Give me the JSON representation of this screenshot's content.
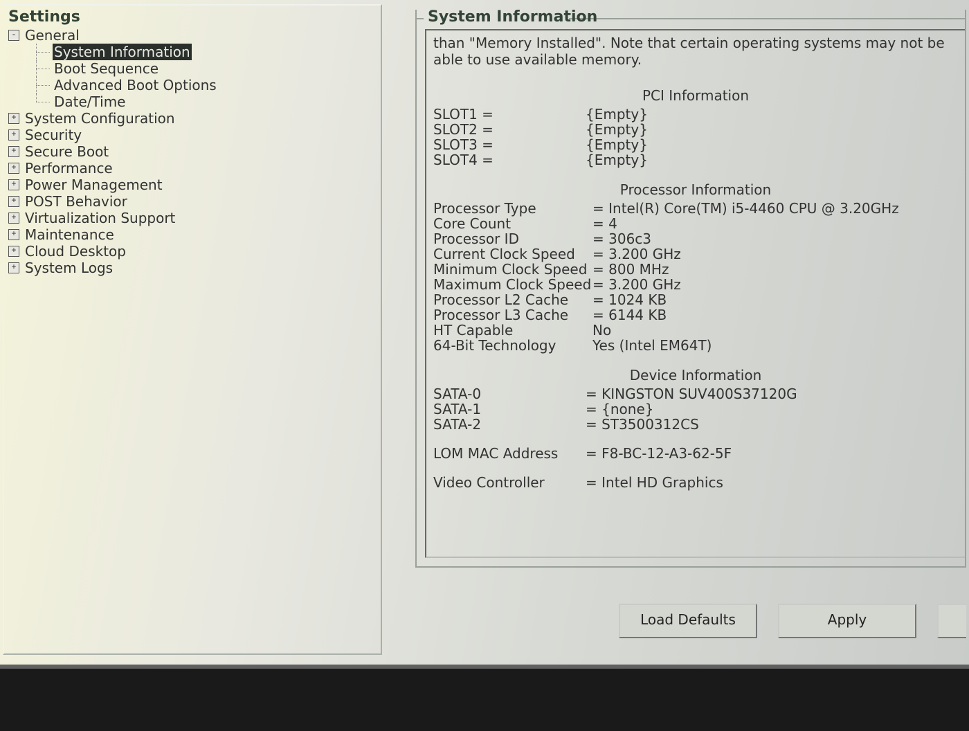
{
  "left": {
    "title": "Settings",
    "general": {
      "label": "General",
      "children": [
        "System Information",
        "Boot Sequence",
        "Advanced Boot Options",
        "Date/Time"
      ],
      "selected_index": 0
    },
    "categories": [
      "System Configuration",
      "Security",
      "Secure Boot",
      "Performance",
      "Power Management",
      "POST Behavior",
      "Virtualization Support",
      "Maintenance",
      "Cloud Desktop",
      "System Logs"
    ]
  },
  "right": {
    "legend": "System Information",
    "note": "than \"Memory Installed\". Note that certain operating systems may not be able to use available memory.",
    "pci": {
      "title": "PCI Information",
      "slots": [
        {
          "label": "SLOT1 =",
          "value": "{Empty}"
        },
        {
          "label": "SLOT2 =",
          "value": "{Empty}"
        },
        {
          "label": "SLOT3 =",
          "value": "{Empty}"
        },
        {
          "label": "SLOT4 =",
          "value": "{Empty}"
        }
      ]
    },
    "proc": {
      "title": "Processor Information",
      "rows": [
        {
          "label": "Processor Type",
          "value": "Intel(R) Core(TM) i5-4460 CPU @ 3.20GHz"
        },
        {
          "label": "Core Count",
          "value": "4"
        },
        {
          "label": "Processor ID",
          "value": "306c3"
        },
        {
          "label": "Current Clock Speed",
          "value": "3.200 GHz"
        },
        {
          "label": "Minimum Clock Speed",
          "value": "800 MHz"
        },
        {
          "label": "Maximum Clock Speed",
          "value": "3.200 GHz"
        },
        {
          "label": "Processor L2 Cache",
          "value": "1024 KB"
        },
        {
          "label": "Processor L3 Cache",
          "value": "6144 KB"
        },
        {
          "label": "HT Capable",
          "value": "No",
          "noeq": true
        },
        {
          "label": "64-Bit Technology",
          "value": "Yes (Intel EM64T)",
          "noeq": true
        }
      ]
    },
    "dev": {
      "title": "Device Information",
      "rows": [
        {
          "label": "SATA-0",
          "value": "KINGSTON SUV400S37120G"
        },
        {
          "label": "SATA-1",
          "value": "{none}"
        },
        {
          "label": "SATA-2",
          "value": "ST3500312CS"
        }
      ],
      "extra": [
        {
          "label": "LOM MAC Address",
          "value": "F8-BC-12-A3-62-5F"
        },
        {
          "label": "Video Controller",
          "value": "Intel HD Graphics"
        }
      ]
    }
  },
  "buttons": {
    "load_defaults": "Load Defaults",
    "apply": "Apply"
  }
}
